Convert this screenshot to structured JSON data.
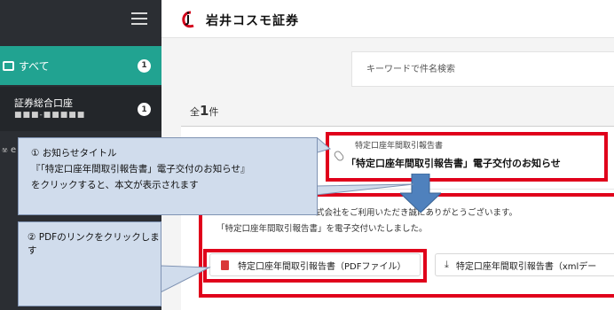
{
  "sidebar": {
    "all_label": "すべて",
    "all_badge": "1",
    "account_label": "証券総合口座",
    "account_masked": "■■■-■■■■■",
    "account_badge": "1",
    "partial_link": "ෂ e"
  },
  "header": {
    "brand": "岩井コスモ証券"
  },
  "search": {
    "placeholder": "キーワードで件名検索"
  },
  "list": {
    "count_prefix": "全",
    "count": "1",
    "count_suffix": "件"
  },
  "message": {
    "category": "特定口座年間取引報告書",
    "title": "「特定口座年間取引報告書」電子交付のお知らせ",
    "body_line1": "式会社をご利用いただき誠にありがとうございます。",
    "body_line2": "「特定口座年間取引報告書」を電子交付いたしました。",
    "pdf_button": "特定口座年間取引報告書（PDFファイル）",
    "xml_button": "特定口座年間取引報告書（xmlデー"
  },
  "callouts": {
    "c1_line1": "① お知らせタイトル",
    "c1_line2": "『「特定口座年間取引報告書」電子交付のお知らせ』",
    "c1_line3": "をクリックすると、本文が表示されます",
    "c2_line1": "② PDFのリンクをクリックします"
  },
  "colors": {
    "accent": "#21a391",
    "highlight": "#e0001b",
    "callout": "#d0dcec",
    "arrow": "#4f81bd"
  }
}
